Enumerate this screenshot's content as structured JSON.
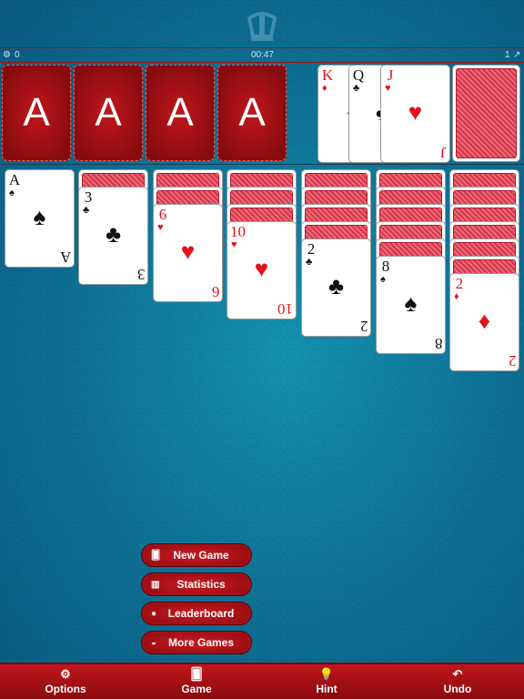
{
  "status": {
    "score": "0",
    "time": "00:47",
    "moves": "1"
  },
  "foundations": [
    "A",
    "A",
    "A",
    "A"
  ],
  "waste": [
    {
      "rank": "K",
      "suit": "♦",
      "color": "red"
    },
    {
      "rank": "Q",
      "suit": "♣",
      "color": "blk"
    },
    {
      "rank": "J",
      "suit": "♥",
      "color": "red"
    }
  ],
  "stock": {
    "face_down": true
  },
  "tableau": [
    {
      "hidden": 0,
      "card": {
        "rank": "A",
        "suit": "♠",
        "color": "blk"
      }
    },
    {
      "hidden": 1,
      "card": {
        "rank": "3",
        "suit": "♣",
        "color": "blk"
      }
    },
    {
      "hidden": 2,
      "card": {
        "rank": "6",
        "suit": "♥",
        "color": "red"
      }
    },
    {
      "hidden": 3,
      "card": {
        "rank": "10",
        "suit": "♥",
        "color": "red"
      }
    },
    {
      "hidden": 4,
      "card": {
        "rank": "2",
        "suit": "♣",
        "color": "blk"
      }
    },
    {
      "hidden": 5,
      "card": {
        "rank": "8",
        "suit": "♠",
        "color": "blk"
      }
    },
    {
      "hidden": 6,
      "card": {
        "rank": "2",
        "suit": "♦",
        "color": "red"
      }
    }
  ],
  "menu": [
    {
      "label": "New Game",
      "icon": "cards-icon"
    },
    {
      "label": "Statistics",
      "icon": "chart-icon"
    },
    {
      "label": "Leaderboard",
      "icon": "leaderboard-icon"
    },
    {
      "label": "More Games",
      "icon": "gamepad-icon"
    }
  ],
  "toolbar": [
    {
      "label": "Options",
      "icon": "gears-icon"
    },
    {
      "label": "Game",
      "icon": "cards-icon"
    },
    {
      "label": "Hint",
      "icon": "lightbulb-icon"
    },
    {
      "label": "Undo",
      "icon": "undo-icon"
    }
  ],
  "colors": {
    "felt": "#0d6f93",
    "leather": "#b3141a"
  }
}
